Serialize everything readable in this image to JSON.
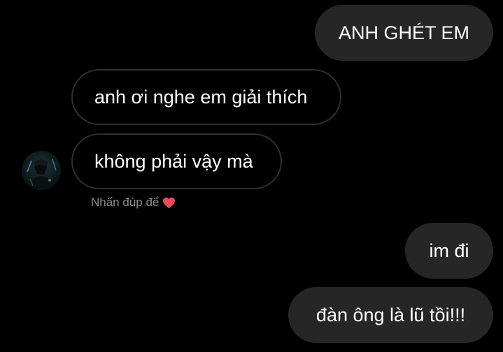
{
  "messages": [
    {
      "id": "m1",
      "direction": "sent",
      "text": "ANH GHÉT EM"
    },
    {
      "id": "m2",
      "direction": "received",
      "text": "anh ơi nghe em giải thích"
    },
    {
      "id": "m3",
      "direction": "received",
      "text": "không phải vậy mà"
    },
    {
      "id": "m4",
      "direction": "sent",
      "text": "im đi"
    },
    {
      "id": "m5",
      "direction": "sent",
      "text": "đàn ông là lũ tồi!!!"
    }
  ],
  "reaction_hint": {
    "text": "Nhấn đúp để",
    "icon": "heart-icon",
    "icon_color": "#ed4956"
  },
  "contact": {
    "avatar_icon": "avatar-photo"
  },
  "colors": {
    "background": "#000000",
    "sent_bubble": "#262626",
    "received_border": "#2f2f2f",
    "text": "#ffffff",
    "hint_text": "#8e8e8e"
  }
}
